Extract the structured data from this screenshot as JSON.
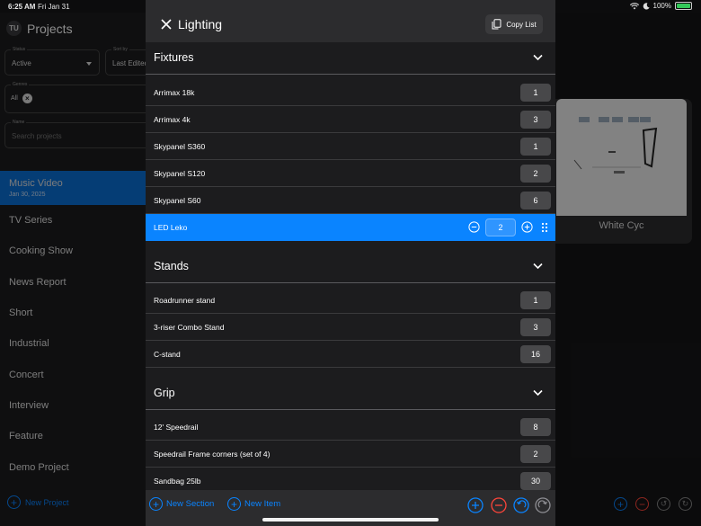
{
  "status_bar": {
    "time": "6:25 AM",
    "date": "Fri Jan 31",
    "battery": "100%"
  },
  "sidebar": {
    "avatar": "TU",
    "title": "Projects",
    "status_filter": {
      "label": "Status",
      "value": "Active"
    },
    "sort_filter": {
      "label": "Sort by",
      "value": "Last Edited"
    },
    "genres_filter": {
      "label": "Genres",
      "value": "All"
    },
    "name_filter": {
      "label": "Name",
      "placeholder": "Search projects"
    },
    "projects": [
      {
        "name": "Music Video",
        "date": "Jan 30, 2025",
        "selected": true
      },
      {
        "name": "TV Series"
      },
      {
        "name": "Cooking Show"
      },
      {
        "name": "News Report"
      },
      {
        "name": "Short"
      },
      {
        "name": "Industrial"
      },
      {
        "name": "Concert"
      },
      {
        "name": "Interview"
      },
      {
        "name": "Feature"
      },
      {
        "name": "Demo Project"
      }
    ],
    "new_project_label": "New Project"
  },
  "main": {
    "card_title": "White Cyc"
  },
  "sheet": {
    "title": "Lighting",
    "copy_label": "Copy List",
    "sections": [
      {
        "title": "Fixtures",
        "items": [
          {
            "name": "Arrimax 18k",
            "qty": "1"
          },
          {
            "name": "Arrimax 4k",
            "qty": "3"
          },
          {
            "name": "Skypanel S360",
            "qty": "1"
          },
          {
            "name": "Skypanel S120",
            "qty": "2"
          },
          {
            "name": "Skypanel S60",
            "qty": "6"
          },
          {
            "name": "LED Leko",
            "qty": "2",
            "active": true
          }
        ]
      },
      {
        "title": "Stands",
        "items": [
          {
            "name": "Roadrunner stand",
            "qty": "1"
          },
          {
            "name": "3-riser Combo Stand",
            "qty": "3"
          },
          {
            "name": "C-stand",
            "qty": "16"
          }
        ]
      },
      {
        "title": "Grip",
        "items": [
          {
            "name": "12' Speedrail",
            "qty": "8"
          },
          {
            "name": "Speedrail Frame corners (set of 4)",
            "qty": "2"
          },
          {
            "name": "Sandbag 25lb",
            "qty": "30"
          }
        ]
      }
    ],
    "footer": {
      "new_section_label": "New Section",
      "new_item_label": "New Item"
    }
  },
  "colors": {
    "accent": "#0a84ff",
    "selected_row": "#0a84ff",
    "danger": "#ff453a",
    "sheet_bg": "#1c1c1e"
  },
  "icons": [
    "close-icon",
    "copy-icon",
    "chevron-down-icon",
    "minus-circle-icon",
    "plus-circle-icon",
    "drag-handle-icon",
    "undo-icon",
    "redo-icon"
  ]
}
